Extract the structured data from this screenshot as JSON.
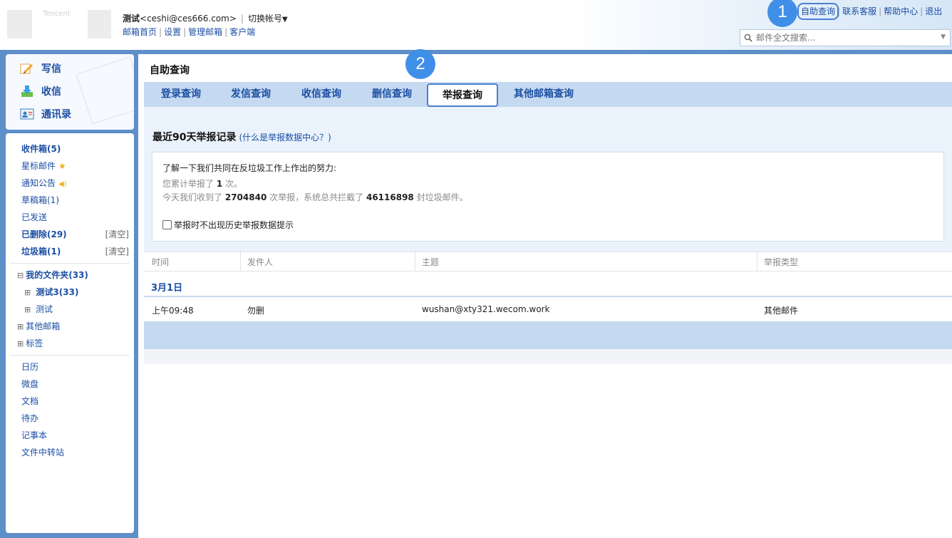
{
  "header": {
    "logo_text": "Tencent",
    "account_name": "测试",
    "account_email": "<ceshi@ces666.com>",
    "separator": "|",
    "switch_account": "切换帐号",
    "nav": [
      "邮箱首页",
      "设置",
      "管理邮箱",
      "客户端"
    ],
    "top_right": [
      "自助查询",
      "联系客服",
      "帮助中心",
      "退出"
    ],
    "search_placeholder": "邮件全文搜索..."
  },
  "markers": [
    "1",
    "2"
  ],
  "sidebar": {
    "quick": [
      {
        "label": "写信",
        "icon": "pencil-icon"
      },
      {
        "label": "收信",
        "icon": "download-icon"
      },
      {
        "label": "通讯录",
        "icon": "contacts-icon"
      }
    ],
    "folders": [
      {
        "label": "收件箱(5)"
      },
      {
        "label": "星标邮件",
        "icon": "star-icon"
      },
      {
        "label": "通知公告",
        "icon": "speaker-icon"
      },
      {
        "label": "草稿箱(1)"
      },
      {
        "label": "已发送"
      },
      {
        "label": "已删除(29)",
        "action": "[清空]"
      },
      {
        "label": "垃圾箱(1)",
        "action": "[清空]"
      }
    ],
    "tree": [
      {
        "label": "我的文件夹(33)",
        "toggle": "⊟"
      },
      {
        "label": "测试3(33)",
        "toggle": "⊞"
      },
      {
        "label": "测试",
        "toggle": "⊞"
      },
      {
        "label": "其他邮箱",
        "toggle": "⊞"
      },
      {
        "label": "标签",
        "toggle": "⊞"
      }
    ],
    "apps": [
      "日历",
      "微盘",
      "文档",
      "待办",
      "记事本",
      "文件中转站"
    ]
  },
  "main": {
    "title": "自助查询",
    "tabs": [
      {
        "label": "登录查询"
      },
      {
        "label": "发信查询"
      },
      {
        "label": "收信查询"
      },
      {
        "label": "删信查询"
      },
      {
        "label": "举报查询",
        "active": true
      },
      {
        "label": "其他邮箱查询"
      }
    ],
    "records_title": "最近90天举报记录",
    "records_link": "(什么是举报数据中心？)",
    "info": {
      "lead": "了解一下我们共同在反垃圾工作上作出的努力:",
      "line1_pre": "您累计举报了",
      "line1_count": "1",
      "line1_post": "次。",
      "line2_pre": "今天我们收到了",
      "line2_reports": "2704840",
      "line2_mid": "次举报，系统总共拦截了",
      "line2_blocked": "46116898",
      "line2_post": "封垃圾邮件。"
    },
    "checkbox_label": "举报时不出现历史举报数据提示",
    "columns": [
      "时间",
      "发件人",
      "主题",
      "举报类型"
    ],
    "date_group": "3月1日",
    "rows": [
      {
        "time": "上午09:48",
        "sender": "勿删",
        "subject": "wushan@xty321.wecom.work",
        "type": "其他邮件"
      }
    ]
  },
  "colors": {
    "frame": "#5d8fc9",
    "link": "#1b4ea3",
    "tabbar": "#c5daf1",
    "marker": "#3f8fe8"
  }
}
